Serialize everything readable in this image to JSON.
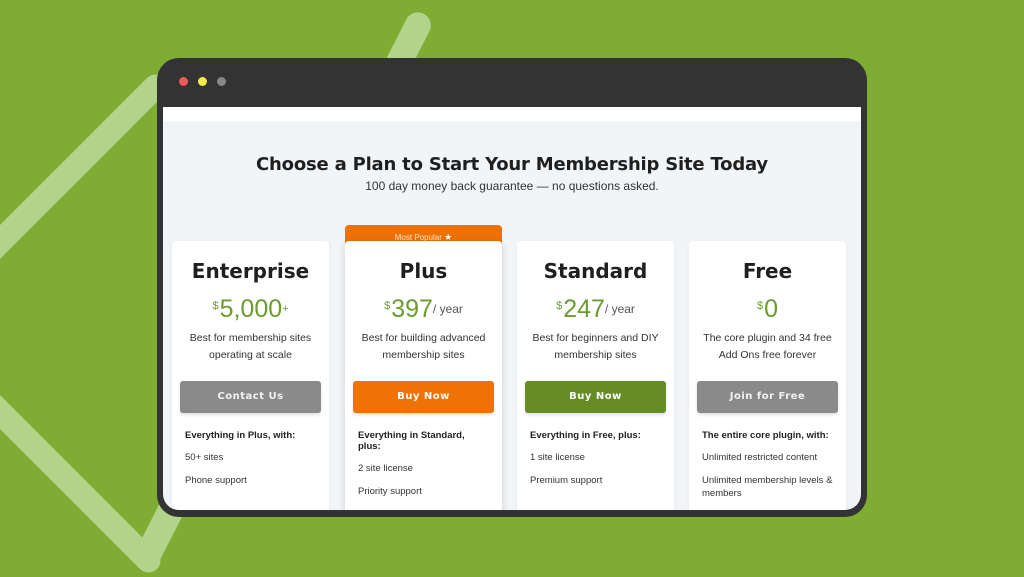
{
  "window": {
    "controls": [
      "close",
      "minimize",
      "maximize"
    ]
  },
  "page": {
    "heading": "Choose a Plan to Start Your Membership Site Today",
    "subheading": "100 day money back guarantee — no questions asked."
  },
  "badge": {
    "label": "Most Popular",
    "icon": "star-icon",
    "icon_glyph": "★"
  },
  "colors": {
    "background": "#7fad33",
    "price_green": "#6b9c30",
    "orange": "#ee7205",
    "green_button": "#658c25",
    "gray_button": "#8a8a8a"
  },
  "plans": [
    {
      "name": "Enterprise",
      "currency": "$",
      "amount": "5,000",
      "suffix": "+",
      "description": "Best for membership sites operating at scale",
      "button": "Contact Us",
      "features_lead": "Everything in Plus, with:",
      "features": [
        "50+ sites",
        "Phone support"
      ]
    },
    {
      "name": "Plus",
      "currency": "$",
      "amount": "397",
      "suffix": "/ year",
      "description": "Best for building advanced membership sites",
      "button": "Buy Now",
      "features_lead": "Everything in Standard, plus:",
      "features": [
        "2 site license",
        "Priority support"
      ]
    },
    {
      "name": "Standard",
      "currency": "$",
      "amount": "247",
      "suffix": "/ year",
      "description": "Best for beginners and DIY membership sites",
      "button": "Buy Now",
      "features_lead": "Everything in Free, plus:",
      "features": [
        "1 site license",
        "Premium support"
      ]
    },
    {
      "name": "Free",
      "currency": "$",
      "amount": "0",
      "suffix": "",
      "description": "The core plugin and 34 free Add Ons free forever",
      "button": "Join for Free",
      "features_lead": "The entire core plugin, with:",
      "features": [
        "Unlimited restricted content",
        "Unlimited membership levels & members"
      ]
    }
  ]
}
